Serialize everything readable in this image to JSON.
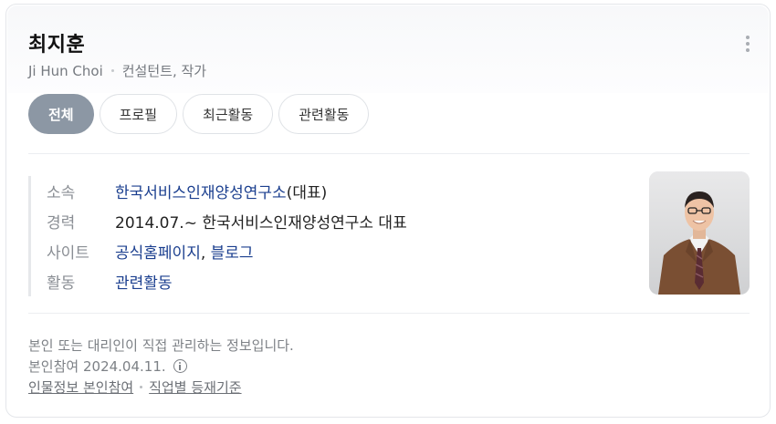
{
  "profile": {
    "name": "최지훈",
    "roman_name": "Ji Hun Choi",
    "occupation": "컨설턴트, 작가"
  },
  "tabs": [
    {
      "label": "전체",
      "active": true
    },
    {
      "label": "프로필",
      "active": false
    },
    {
      "label": "최근활동",
      "active": false
    },
    {
      "label": "관련활동",
      "active": false
    }
  ],
  "info": {
    "affiliation": {
      "label": "소속",
      "link": "한국서비스인재양성연구소",
      "suffix": "(대표)"
    },
    "career": {
      "label": "경력",
      "value": "2014.07.~ 한국서비스인재양성연구소 대표"
    },
    "site": {
      "label": "사이트",
      "link1": "공식홈페이지",
      "comma": ",",
      "link2": "블로그"
    },
    "activity": {
      "label": "활동",
      "link": "관련활동"
    }
  },
  "footer": {
    "notice": "본인 또는 대리인이 직접 관리하는 정보입니다.",
    "participation_label": "본인참여",
    "participation_date": "2024.04.11.",
    "link1": "인물정보 본인참여",
    "link2": "직업별 등재기준"
  },
  "icons": {
    "more": "more-vertical-icon",
    "info": "info-circle-icon"
  },
  "colors": {
    "active_tab": "#8c97a4",
    "link": "#1b3f8f",
    "muted_text": "#8a8e94"
  }
}
